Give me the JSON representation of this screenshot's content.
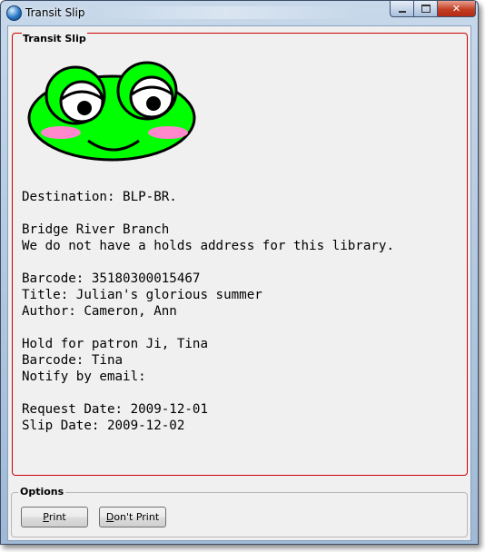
{
  "window": {
    "title": "Transit Slip"
  },
  "slip": {
    "label": "Transit Slip",
    "lines": [
      "Destination: BLP-BR.",
      "",
      "Bridge River Branch",
      "We do not have a holds address for this library.",
      "",
      "Barcode: 35180300015467",
      "Title: Julian's glorious summer",
      "Author: Cameron, Ann",
      "",
      "Hold for patron Ji, Tina",
      "Barcode: Tina",
      "Notify by email:",
      "",
      "Request Date: 2009-12-01",
      "Slip Date: 2009-12-02"
    ],
    "colors": {
      "frame": "#cc0000",
      "frog_green": "#00ff00",
      "frog_cheek": "#ff88cc"
    }
  },
  "options": {
    "label": "Options",
    "print_mnemonic": "P",
    "print_rest": "rint",
    "dont_print_mnemonic": "D",
    "dont_print_rest": "on't Print"
  },
  "icons": {
    "app": "globe-icon",
    "minimize": "minimize-icon",
    "maximize": "maximize-icon",
    "close": "close-icon",
    "frog": "frog-icon"
  }
}
